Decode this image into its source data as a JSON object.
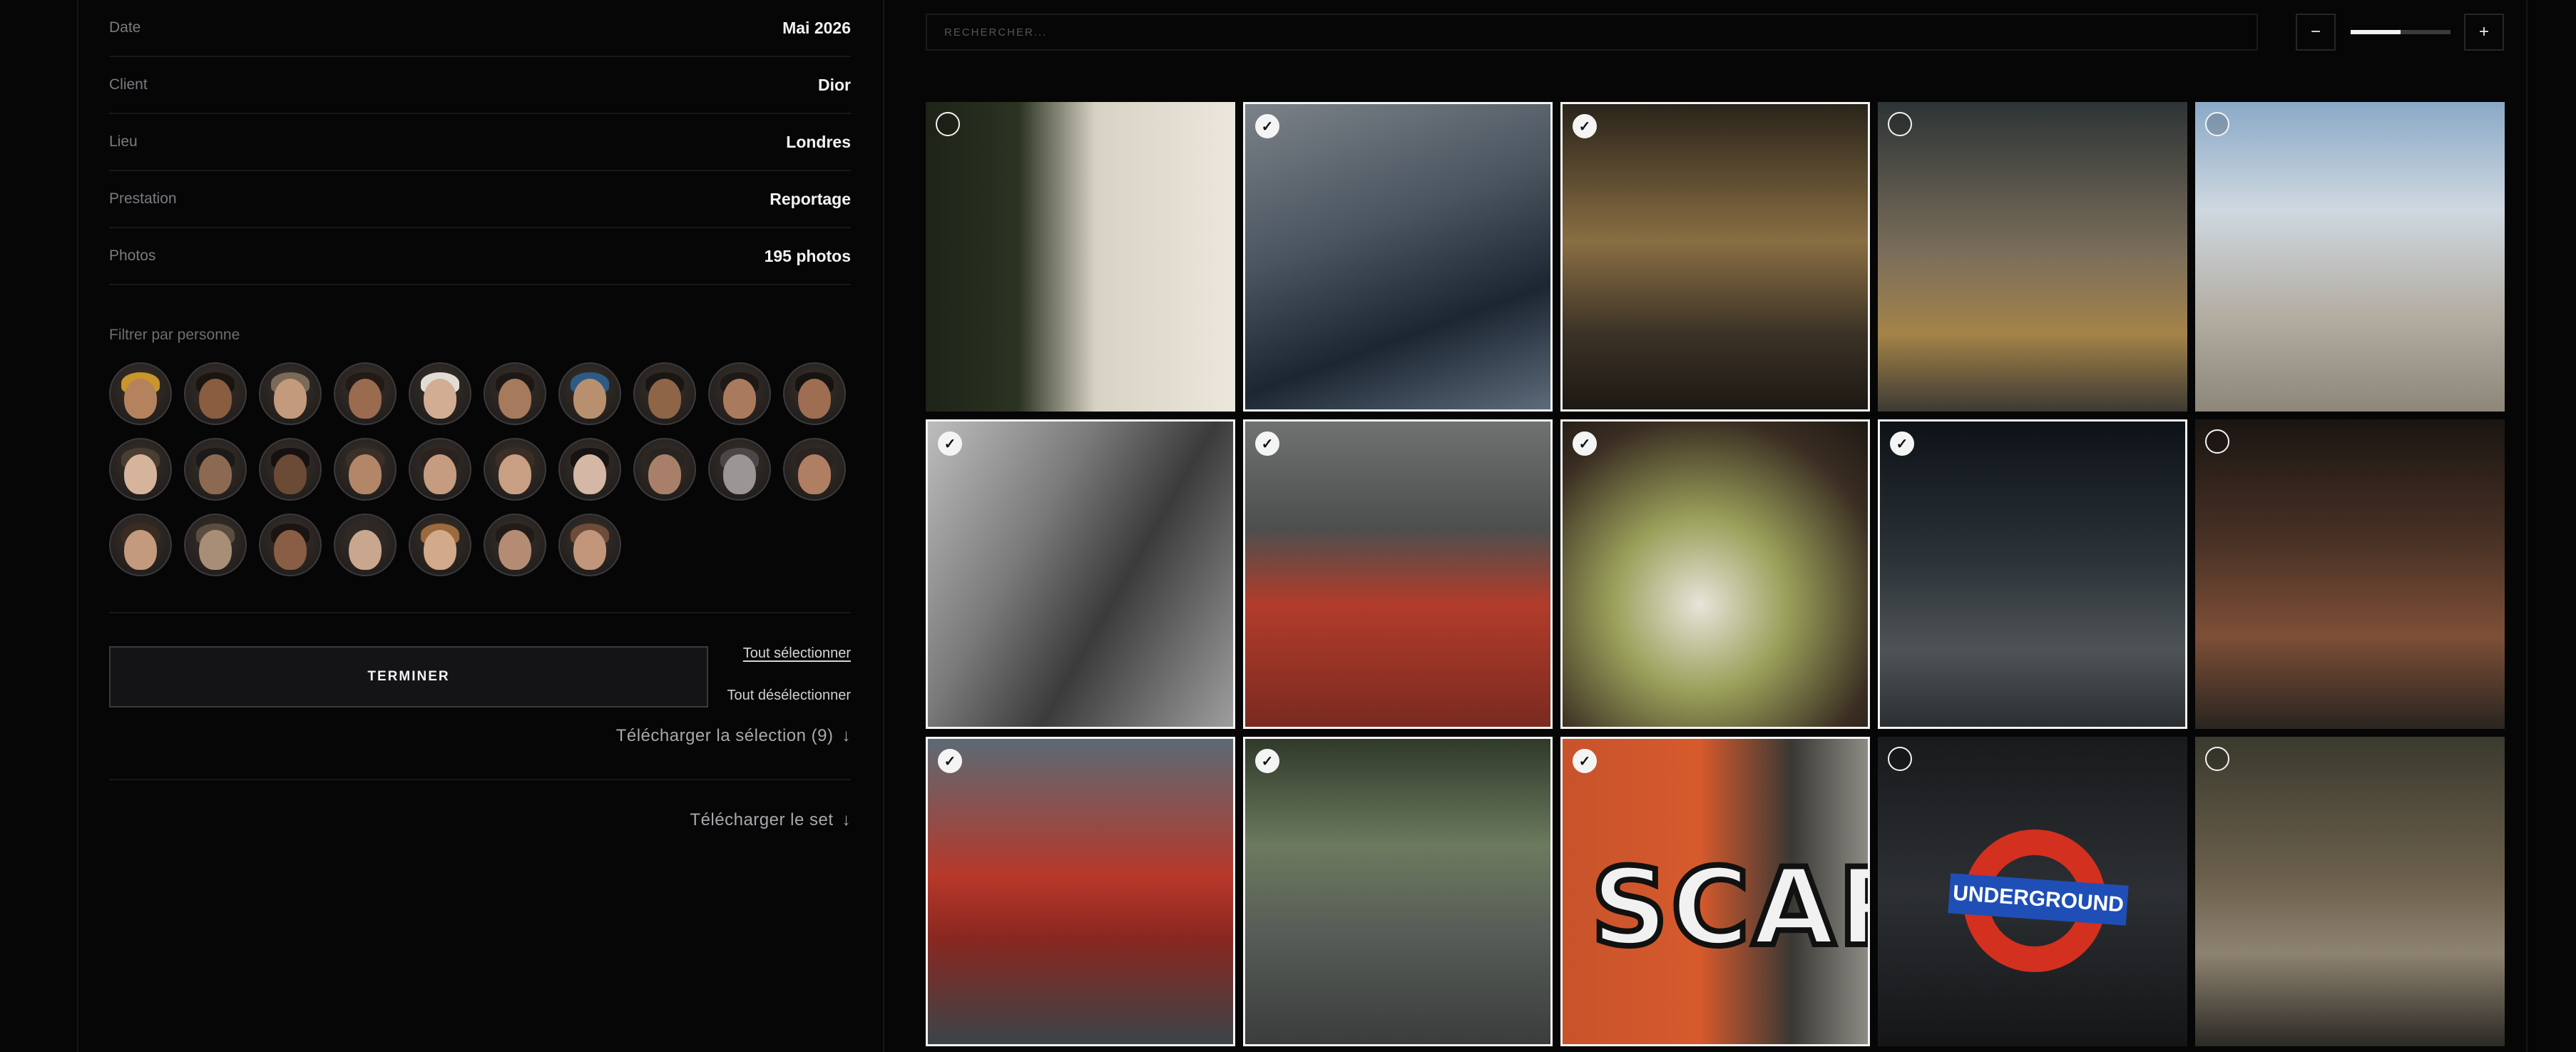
{
  "project": {
    "rows": [
      {
        "key": "Date",
        "value": "Mai 2026"
      },
      {
        "key": "Client",
        "value": "Dior"
      },
      {
        "key": "Lieu",
        "value": "Londres"
      },
      {
        "key": "Prestation",
        "value": "Reportage"
      },
      {
        "key": "Photos",
        "value": "195 photos"
      }
    ]
  },
  "filter": {
    "label": "Filtrer par personne",
    "people": [
      {
        "skin": "#b4835e",
        "hair": "#c8962b"
      },
      {
        "skin": "#8a5d40",
        "hair": "#1b1512"
      },
      {
        "skin": "#c39a7c",
        "hair": "#7a6a58"
      },
      {
        "skin": "#9a6b4f",
        "hair": "#231a15"
      },
      {
        "skin": "#d2ad94",
        "hair": "#e0dcd6"
      },
      {
        "skin": "#a57a5d",
        "hair": "#1d1816"
      },
      {
        "skin": "#b9906f",
        "hair": "#2d5b86"
      },
      {
        "skin": "#8f6548",
        "hair": "#1a1614"
      },
      {
        "skin": "#a97b5c",
        "hair": "#1e1916"
      },
      {
        "skin": "#9e6d52",
        "hair": "#171311"
      },
      {
        "skin": "#d6b49c",
        "hair": "#4a3d32"
      },
      {
        "skin": "#8c6a51",
        "hair": "#1c1a18"
      },
      {
        "skin": "#6b4a36",
        "hair": "#141110"
      },
      {
        "skin": "#b38667",
        "hair": "#3b2f28"
      },
      {
        "skin": "#c59c80",
        "hair": "#2c221d"
      },
      {
        "skin": "#c99f83",
        "hair": "#3a2e26"
      },
      {
        "skin": "#d4b7a4",
        "hair": "#161312"
      },
      {
        "skin": "#a8806a",
        "hair": "#2a2420"
      },
      {
        "skin": "#9a9696",
        "hair": "#4b4747"
      },
      {
        "skin": "#b07f63",
        "hair": "#2b2320"
      },
      {
        "skin": "#c49a7f",
        "hair": "#3a2c22"
      },
      {
        "skin": "#a98e77",
        "hair": "#5b4d40"
      },
      {
        "skin": "#8a5e44",
        "hair": "#1a1512"
      },
      {
        "skin": "#c8a78e",
        "hair": "#2f2824"
      },
      {
        "skin": "#d3a98b",
        "hair": "#9b6b3d"
      },
      {
        "skin": "#b48c73",
        "hair": "#221c18"
      },
      {
        "skin": "#c1967a",
        "hair": "#6d4d3a"
      }
    ]
  },
  "actions": {
    "finish": "TERMINER",
    "select_all": "Tout sélectionner",
    "deselect_all": "Tout désélectionner",
    "download_selection": "Télécharger la sélection (9)",
    "download_set": "Télécharger le set",
    "arrow": "↓"
  },
  "search": {
    "placeholder": "RECHERCHER..."
  },
  "zoom": {
    "minus": "−",
    "plus": "+",
    "level": 0.5
  },
  "check_glyph": "✓",
  "photos": [
    {
      "name": "building-doorway",
      "selected": false,
      "bg": "linear-gradient(90deg,#1e2318 0%,#2b3322 30%,#d8d2c4 55%,#ece7dc 100%)"
    },
    {
      "name": "glass-tower",
      "selected": true,
      "bg": "linear-gradient(160deg,#7b8188 0%,#4a5560 40%,#1c2632 70%,#5c6b7a 100%)"
    },
    {
      "name": "street-walkers",
      "selected": true,
      "bg": "linear-gradient(180deg,#2a241a 0%,#8a6e43 45%,#3c3326 75%,#1c1813 100%)"
    },
    {
      "name": "paella-chefs",
      "selected": false,
      "bg": "linear-gradient(180deg,#2d3436 0%,#7d6f5b 50%,#a48348 75%,#3d3a34 100%)"
    },
    {
      "name": "clock-tower",
      "selected": false,
      "bg": "linear-gradient(180deg,#8aa9c7 0%,#cfd8e0 35%,#b2aca1 70%,#8d8679 100%)"
    },
    {
      "name": "skyscraper-bw",
      "selected": true,
      "bg": "linear-gradient(120deg,#bdbdbd 0%,#7a7a7a 35%,#3b3b3b 60%,#9e9e9e 100%)"
    },
    {
      "name": "market-tomatoes",
      "selected": true,
      "bg": "linear-gradient(180deg,#6f7270 0%,#4c4f4e 35%,#b23c2a 60%,#7a2a20 100%)"
    },
    {
      "name": "food-plates",
      "selected": true,
      "bg": "radial-gradient(circle at 45% 60%,#e8e4da 0%,#9aa05a 35%,#3a2d22 75%,#1e1913 100%)"
    },
    {
      "name": "night-street",
      "selected": true,
      "bg": "linear-gradient(180deg,#0d1217 0%,#2b3338 45%,#4e5356 75%,#2c2f31 100%)"
    },
    {
      "name": "night-buildings",
      "selected": false,
      "bg": "linear-gradient(180deg,#1a1512 0%,#4a3226 40%,#7e4f37 70%,#2a2520 100%)"
    },
    {
      "name": "red-bus",
      "selected": true,
      "bg": "linear-gradient(180deg,#5b6a74 0%,#b7382a 45%,#8a2720 65%,#3b4448 100%)"
    },
    {
      "name": "tree-road",
      "selected": true,
      "bg": "linear-gradient(180deg,#2f3a2a 0%,#6c7a5e 35%,#565b57 65%,#3a3d3c 100%)"
    },
    {
      "name": "scar-mural",
      "selected": true,
      "bg": "linear-gradient(90deg,#c8532b 0%,#d65a2c 45%,#3a3834 75%,#8d8b84 100%)"
    },
    {
      "name": "underground-sign",
      "selected": false,
      "bg": "linear-gradient(180deg,#181a1c 0%,#2c2f33 50%,#141517 100%)"
    },
    {
      "name": "lion-statue",
      "selected": false,
      "bg": "linear-gradient(180deg,#3a3a2e 0%,#6b5f4b 45%,#8e8371 70%,#2c2a25 100%)"
    }
  ],
  "photo_labels": {
    "underground": "UNDERGROUND",
    "mural": "SCAR"
  }
}
